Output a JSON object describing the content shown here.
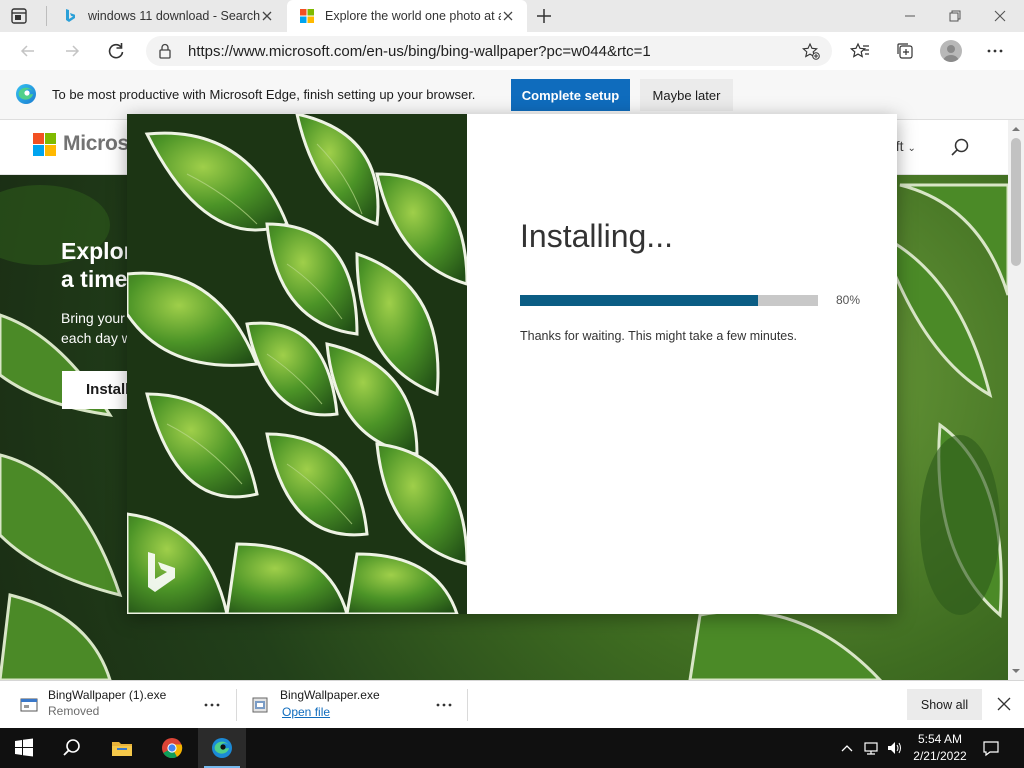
{
  "browser": {
    "tabs": [
      {
        "title": "windows 11 download - Search",
        "active": false
      },
      {
        "title": "Explore the world one photo at a time",
        "active": true
      }
    ],
    "address_url": "https://www.microsoft.com/en-us/bing/bing-wallpaper?pc=w044&rtc=1"
  },
  "infobar": {
    "message": "To be most productive with Microsoft Edge, finish setting up your browser.",
    "primary_label": "Complete setup",
    "secondary_label": "Maybe later"
  },
  "page": {
    "brand": "Microsoft",
    "account_label": "oft",
    "hero_title_line1": "Explor",
    "hero_title_line2": "a time",
    "hero_sub_line1": "Bring your",
    "hero_sub_line2": "each day w",
    "hero_button": "Install"
  },
  "dialog": {
    "title": "Installing...",
    "progress": 0.8,
    "progress_label": "80%",
    "message": "Thanks for waiting. This might take a few minutes."
  },
  "downloads": {
    "items": [
      {
        "name": "BingWallpaper (1).exe",
        "status": "Removed"
      },
      {
        "name": "BingWallpaper.exe",
        "action": "Open file"
      }
    ],
    "show_all": "Show all"
  },
  "taskbar": {
    "time": "5:54 AM",
    "date": "2/21/2022"
  },
  "colors": {
    "accent_blue": "#0f6cbd",
    "progress_fill": "#0b5d84",
    "progress_track": "#c8c8c8",
    "taskbar": "#101010"
  }
}
